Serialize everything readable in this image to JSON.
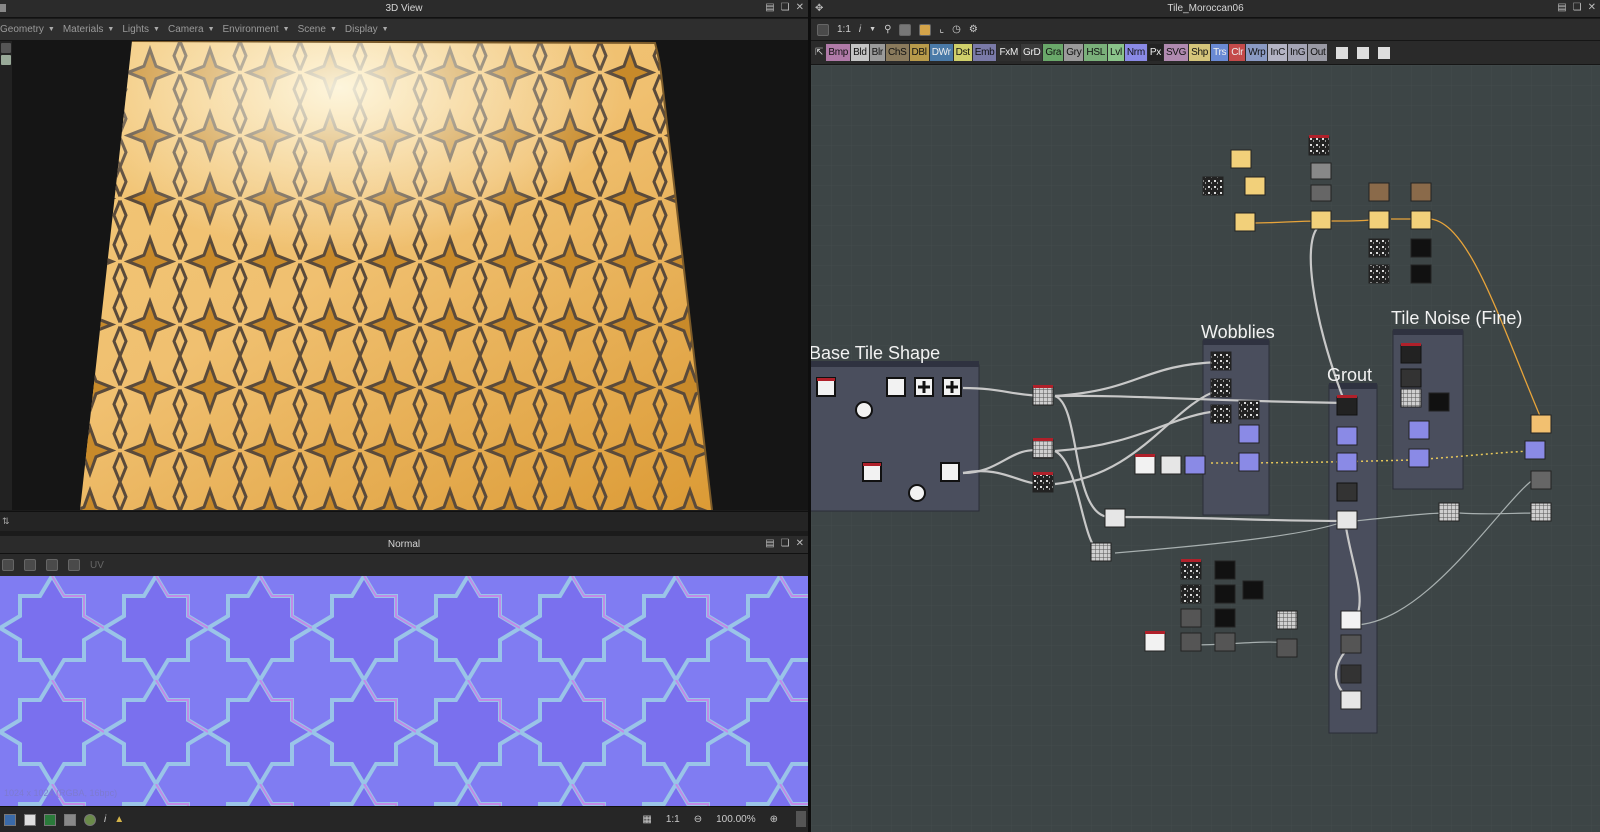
{
  "left_top": {
    "title": "3D View",
    "menu": [
      "Geometry",
      "Materials",
      "Lights",
      "Camera",
      "Environment",
      "Scene",
      "Display"
    ]
  },
  "left_bottom": {
    "title": "Normal",
    "uv_label": "UV",
    "image_info": "1024 x 1024 (RGBA, 16bpc)",
    "zoom_ratio": "1:1",
    "zoom_level": "100.00%"
  },
  "graph": {
    "title": "Tile_Moroccan06",
    "toolbar_ratio": "1:1",
    "toolbar_info": "i",
    "node_buttons": [
      {
        "label": "Bmp",
        "color": "#b07aa8"
      },
      {
        "label": "Bld",
        "color": "#c4c4c4"
      },
      {
        "label": "Blr",
        "color": "#9a9a9a"
      },
      {
        "label": "ChS",
        "color": "#8a7a5c"
      },
      {
        "label": "DBl",
        "color": "#b89a4a"
      },
      {
        "label": "DWr",
        "color": "#4a7aa8"
      },
      {
        "label": "Dst",
        "color": "#cfcf6a"
      },
      {
        "label": "Emb",
        "color": "#7a7aa8"
      },
      {
        "label": "FxM",
        "color": "#2f2f2f"
      },
      {
        "label": "GrD",
        "color": "#3a3a3a"
      },
      {
        "label": "Gra",
        "color": "#6aa86a"
      },
      {
        "label": "Gry",
        "color": "#9a9a9a"
      },
      {
        "label": "HSL",
        "color": "#7ab07a"
      },
      {
        "label": "Lvl",
        "color": "#8ac48a"
      },
      {
        "label": "Nrm",
        "color": "#8a8ae6"
      },
      {
        "label": "Px",
        "color": "#222222"
      },
      {
        "label": "SVG",
        "color": "#b08ab0"
      },
      {
        "label": "Shp",
        "color": "#d4c47a"
      },
      {
        "label": "Trs",
        "color": "#6a8ad4"
      },
      {
        "label": "Clr",
        "color": "#c44a4a"
      },
      {
        "label": "Wrp",
        "color": "#8a9ac4"
      },
      {
        "label": "InC",
        "color": "#b4b4c4"
      },
      {
        "label": "InG",
        "color": "#a4a4b4"
      },
      {
        "label": "Out",
        "color": "#9a9aa4"
      }
    ],
    "frames": [
      {
        "title": "Base Tile Shape"
      },
      {
        "title": "Wobblies"
      },
      {
        "title": "Grout"
      },
      {
        "title": "Tile Noise (Fine)"
      }
    ]
  },
  "colors": {
    "gold": "#e8b455",
    "normal_blue": "#7e7bf1",
    "graph_bg": "#3d4546",
    "frame_bg": "#4a5060"
  }
}
